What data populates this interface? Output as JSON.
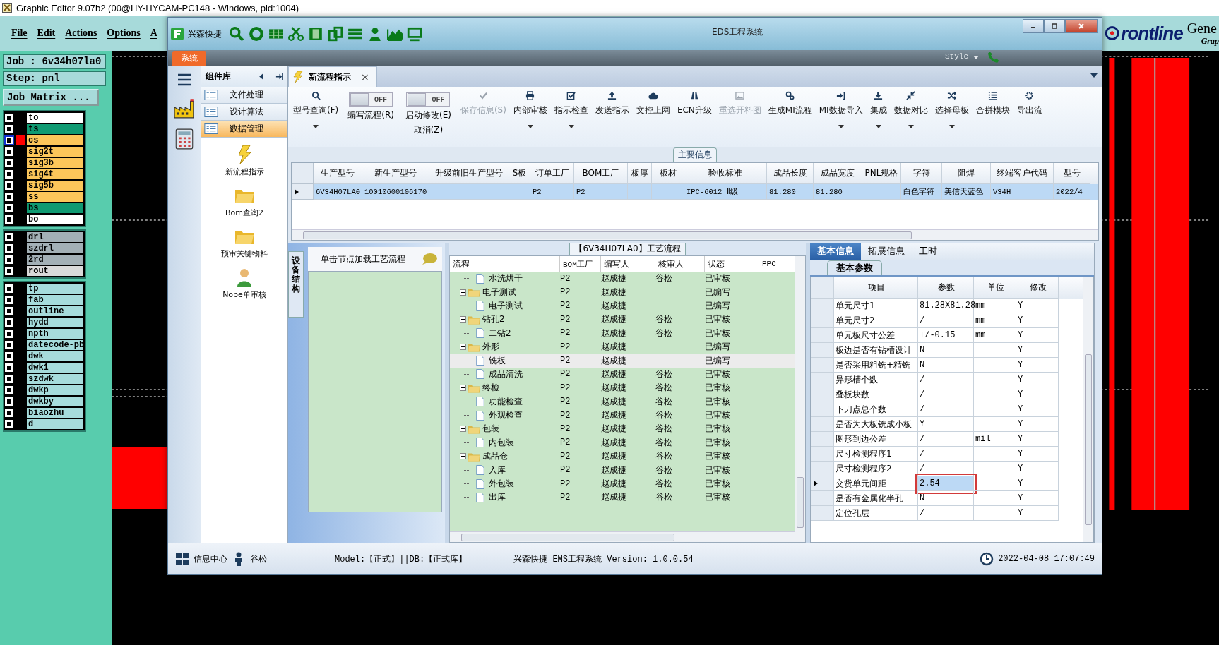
{
  "graphic_editor": {
    "title": "Graphic Editor 9.07b2 (00@HY-HYCAM-PC148 - Windows, pid:1004)",
    "menu": [
      "File",
      "Edit",
      "Actions",
      "Options",
      "A"
    ],
    "job": "Job : 6v34h07la0",
    "step": "Step: pnl",
    "job_matrix": "Job Matrix ...",
    "layer_groups": [
      [
        {
          "name": "to",
          "color": "#ffffff",
          "selected": false,
          "checked": false
        },
        {
          "name": "ts",
          "color": "#109a72",
          "selected": false,
          "checked": false
        },
        {
          "name": "cs",
          "color": "#fcc65a",
          "selected": true,
          "checked": false
        },
        {
          "name": "sig2t",
          "color": "#fcc65a",
          "selected": false,
          "checked": false
        },
        {
          "name": "sig3b",
          "color": "#fcc65a",
          "selected": false,
          "checked": false
        },
        {
          "name": "sig4t",
          "color": "#fcc65a",
          "selected": false,
          "checked": false
        },
        {
          "name": "sig5b",
          "color": "#fcc65a",
          "selected": false,
          "checked": false
        },
        {
          "name": "ss",
          "color": "#fcc65a",
          "selected": false,
          "checked": false
        },
        {
          "name": "bs",
          "color": "#109a72",
          "selected": false,
          "checked": false
        },
        {
          "name": "bo",
          "color": "#ffffff",
          "selected": false,
          "checked": false
        }
      ],
      [
        {
          "name": "drl",
          "color": "#a3b0b6",
          "selected": false,
          "checked": false
        },
        {
          "name": "szdrl",
          "color": "#a3b0b6",
          "selected": false,
          "checked": false
        },
        {
          "name": "2rd",
          "color": "#a3b0b6",
          "selected": false,
          "checked": false
        },
        {
          "name": "rout",
          "color": "#dadada",
          "selected": false,
          "checked": false
        }
      ],
      [
        {
          "name": "tp",
          "color": "#a6dcdc",
          "selected": false,
          "checked": false
        },
        {
          "name": "fab",
          "color": "#a6dcdc",
          "selected": false,
          "checked": false
        },
        {
          "name": "outline",
          "color": "#a6dcdc",
          "selected": false,
          "checked": false
        },
        {
          "name": "hydd",
          "color": "#a6dcdc",
          "selected": false,
          "checked": false
        },
        {
          "name": "npth",
          "color": "#a6dcdc",
          "selected": false,
          "checked": false
        },
        {
          "name": "datecode-pb",
          "color": "#a6dcdc",
          "selected": false,
          "checked": false
        },
        {
          "name": "dwk",
          "color": "#a6dcdc",
          "selected": false,
          "checked": false
        },
        {
          "name": "dwk1",
          "color": "#a6dcdc",
          "selected": false,
          "checked": false
        },
        {
          "name": "szdwk",
          "color": "#a6dcdc",
          "selected": false,
          "checked": false
        },
        {
          "name": "dwkp",
          "color": "#a6dcdc",
          "selected": false,
          "checked": false
        },
        {
          "name": "dwkby",
          "color": "#a6dcdc",
          "selected": false,
          "checked": false
        },
        {
          "name": "biaozhu",
          "color": "#a6dcdc",
          "selected": false,
          "checked": false
        },
        {
          "name": "d",
          "color": "#a6dcdc",
          "selected": false,
          "checked": false
        }
      ]
    ],
    "logo": "rontline",
    "brand": "Gene",
    "brand_sub": "Grap"
  },
  "eds": {
    "title": "EDS工程系统",
    "app_name": "兴森快捷",
    "style_menu": "Style",
    "system_tab": "系统",
    "component_library": {
      "title": "组件库",
      "categories": [
        {
          "label": "文件处理",
          "selected": false
        },
        {
          "label": "设计算法",
          "selected": false
        },
        {
          "label": "数据管理",
          "selected": true
        }
      ],
      "tools": [
        {
          "label": "新流程指示",
          "kind": "lightning"
        },
        {
          "label": "Bom查询2",
          "kind": "folder"
        },
        {
          "label": "预审关键物料",
          "kind": "folder"
        },
        {
          "label": "Nope单审核",
          "kind": "person"
        }
      ]
    },
    "doc_tab": {
      "label": "新流程指示",
      "close": "×"
    },
    "ribbon": [
      {
        "kind": "button",
        "label": "型号查询(F)",
        "dropdown": true,
        "disabled": false
      },
      {
        "kind": "toggle",
        "label": "编写流程(R)",
        "text": "OFF",
        "on": false
      },
      {
        "kind": "toggle",
        "label": "启动修改(E)",
        "sublabel": "取消(Z)",
        "text": "OFF",
        "on": false
      },
      {
        "kind": "button",
        "label": "保存信息(S)",
        "dropdown": false,
        "disabled": true
      },
      {
        "kind": "button",
        "label": "内部审核",
        "dropdown": true,
        "disabled": false
      },
      {
        "kind": "button",
        "label": "指示检查",
        "dropdown": true,
        "disabled": false
      },
      {
        "kind": "button",
        "label": "发送指示",
        "dropdown": false,
        "disabled": false
      },
      {
        "kind": "button",
        "label": "文控上网",
        "dropdown": false,
        "disabled": false
      },
      {
        "kind": "button",
        "label": "ECN升级",
        "dropdown": false,
        "disabled": false
      },
      {
        "kind": "button",
        "label": "重选开料图",
        "dropdown": false,
        "disabled": true
      },
      {
        "kind": "button",
        "label": "生成MI流程",
        "dropdown": false,
        "disabled": false
      },
      {
        "kind": "button",
        "label": "MI数据导入",
        "dropdown": true,
        "disabled": false
      },
      {
        "kind": "button",
        "label": "集成",
        "dropdown": true,
        "disabled": false
      },
      {
        "kind": "button",
        "label": "数据对比",
        "dropdown": true,
        "disabled": false
      },
      {
        "kind": "button",
        "label": "选择母板",
        "dropdown": true,
        "disabled": false
      },
      {
        "kind": "button",
        "label": "合拼模块",
        "dropdown": false,
        "disabled": false
      },
      {
        "kind": "button",
        "label": "导出流",
        "dropdown": false,
        "disabled": false
      }
    ],
    "main_info": {
      "title": "主要信息",
      "columns": [
        "生产型号",
        "新生产型号",
        "升级前旧生产型号",
        "S板",
        "订单工厂",
        "BOM工厂",
        "板厚",
        "板材",
        "验收标准",
        "成品长度",
        "成品宽度",
        "PNL规格",
        "字符",
        "阻焊",
        "终端客户代码",
        "型号"
      ],
      "rows": [
        {
          "selected": true,
          "cells": [
            "6V34H07LA0",
            "10010600106170",
            null,
            null,
            "P2",
            "P2",
            null,
            null,
            "IPC-6012 Ⅱ级",
            "81.280",
            "81.280",
            null,
            "白色字符",
            "美信天蓝色",
            "V34H",
            "2022/4"
          ]
        }
      ]
    },
    "flow": {
      "title": "【6V34H07LA0】工艺流程",
      "side_tab": "设备结构",
      "hint": "单击节点加载工艺流程",
      "columns": [
        "流程",
        "BOM工厂",
        "编写人",
        "核审人",
        "状态",
        "PPC"
      ],
      "tree": [
        {
          "children": [
            {
              "name": "水洗烘干",
              "bom": "P2",
              "writer": "赵成捷",
              "reviewer": "谷松",
              "status": "已审核",
              "selected": false
            }
          ]
        },
        {
          "name": "电子测试",
          "bom": "P2",
          "writer": "赵成捷",
          "status": "已编写",
          "selected": false,
          "children": [
            {
              "name": "电子测试",
              "bom": "P2",
              "writer": "赵成捷",
              "status": "已编写",
              "selected": false
            }
          ]
        },
        {
          "name": "钻孔2",
          "bom": "P2",
          "writer": "赵成捷",
          "reviewer": "谷松",
          "status": "已审核",
          "selected": false,
          "children": [
            {
              "name": "二钻2",
              "bom": "P2",
              "writer": "赵成捷",
              "reviewer": "谷松",
              "status": "已审核",
              "selected": false
            }
          ]
        },
        {
          "name": "外形",
          "bom": "P2",
          "writer": "赵成捷",
          "status": "已编写",
          "selected": false,
          "children": [
            {
              "name": "铣板",
              "bom": "P2",
              "writer": "赵成捷",
              "status": "已编写",
              "selected": true
            },
            {
              "name": "成品清洗",
              "bom": "P2",
              "writer": "赵成捷",
              "reviewer": "谷松",
              "status": "已审核",
              "selected": false
            }
          ]
        },
        {
          "name": "终检",
          "bom": "P2",
          "writer": "赵成捷",
          "reviewer": "谷松",
          "status": "已审核",
          "selected": false,
          "children": [
            {
              "name": "功能检查",
              "bom": "P2",
              "writer": "赵成捷",
              "reviewer": "谷松",
              "status": "已审核",
              "selected": false
            },
            {
              "name": "外观检查",
              "bom": "P2",
              "writer": "赵成捷",
              "reviewer": "谷松",
              "status": "已审核",
              "selected": false
            }
          ]
        },
        {
          "name": "包装",
          "bom": "P2",
          "writer": "赵成捷",
          "reviewer": "谷松",
          "status": "已审核",
          "selected": false,
          "children": [
            {
              "name": "内包装",
              "bom": "P2",
              "writer": "赵成捷",
              "reviewer": "谷松",
              "status": "已审核",
              "selected": false
            }
          ]
        },
        {
          "name": "成品仓",
          "bom": "P2",
          "writer": "赵成捷",
          "reviewer": "谷松",
          "status": "已审核",
          "selected": false,
          "children": [
            {
              "name": "入库",
              "bom": "P2",
              "writer": "赵成捷",
              "reviewer": "谷松",
              "status": "已审核",
              "selected": false
            },
            {
              "name": "外包装",
              "bom": "P2",
              "writer": "赵成捷",
              "reviewer": "谷松",
              "status": "已审核",
              "selected": false
            },
            {
              "name": "出库",
              "bom": "P2",
              "writer": "赵成捷",
              "reviewer": "谷松",
              "status": "已审核",
              "selected": false
            }
          ]
        }
      ]
    },
    "params": {
      "tabs": [
        {
          "label": "基本信息",
          "selected": true
        },
        {
          "label": "拓展信息",
          "selected": false
        },
        {
          "label": "工时",
          "selected": false
        }
      ],
      "subtab": "基本参数",
      "columns": [
        "项目",
        "参数",
        "单位",
        "修改"
      ],
      "rows": [
        {
          "item": "单元尺寸1",
          "value": "81.28X81.28",
          "unit": "mm",
          "modify": "Y",
          "selected": false
        },
        {
          "item": "单元尺寸2",
          "value": "/",
          "unit": "mm",
          "modify": "Y",
          "selected": false
        },
        {
          "item": "单元板尺寸公差",
          "value": "+/-0.15",
          "unit": "mm",
          "modify": "Y",
          "selected": false
        },
        {
          "item": "板边是否有钻槽设计",
          "value": "N",
          "modify": "Y",
          "selected": false
        },
        {
          "item": "是否采用粗铣+精铣",
          "value": "N",
          "modify": "Y",
          "selected": false
        },
        {
          "item": "异形槽个数",
          "value": "/",
          "modify": "Y",
          "selected": false
        },
        {
          "item": "叠板块数",
          "value": "/",
          "modify": "Y",
          "selected": false
        },
        {
          "item": "下刀点总个数",
          "value": "/",
          "modify": "Y",
          "selected": false
        },
        {
          "item": "是否为大板铣成小板",
          "value": "Y",
          "modify": "Y",
          "selected": false
        },
        {
          "item": "图形到边公差",
          "value": "/",
          "unit": "mil",
          "modify": "Y",
          "selected": false
        },
        {
          "item": "尺寸检测程序1",
          "value": "/",
          "modify": "Y",
          "selected": false
        },
        {
          "item": "尺寸检测程序2",
          "value": "/",
          "modify": "Y",
          "selected": false
        },
        {
          "item": "交货单元间距",
          "value": "2.54",
          "modify": "Y",
          "selected": true
        },
        {
          "item": "是否有金属化半孔",
          "value": "N",
          "modify": "Y",
          "selected": false
        },
        {
          "item": "定位孔层",
          "value": "/",
          "modify": "Y",
          "selected": false
        }
      ]
    },
    "status": {
      "info_center": "信息中心",
      "user": "谷松",
      "model": "Model:【正式】||DB:【正式库】",
      "version": "兴森快捷 EMS工程系统 Version: 1.0.0.54",
      "time": "2022-04-08 17:07:49"
    }
  }
}
